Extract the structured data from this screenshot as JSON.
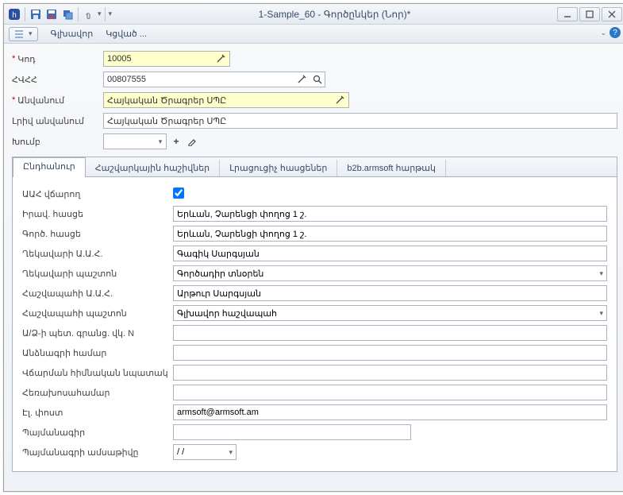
{
  "window": {
    "title": "1-Sample_60 - Գործընկեր (Նոր)*"
  },
  "menu": {
    "main": "Գլխավոր",
    "attached": "Կցված ..."
  },
  "form": {
    "code_label": "Կոդ",
    "code_value": "10005",
    "hvrr_label": "ՀՎՀՀ",
    "hvrr_value": "00807555",
    "name_label": "Անվանում",
    "name_value": "Հայկական Ծրագրեր ՍՊԸ",
    "fullname_label": "Լրիվ անվանում",
    "fullname_value": "Հայկական Ծրագրեր ՍՊԸ",
    "group_label": "Խումբ",
    "group_value": ""
  },
  "tabs": {
    "t1": "Ընդհանուր",
    "t2": "Հաշվարկային հաշիվներ",
    "t3": "Լրացուցիչ հասցեներ",
    "t4": "b2b.armsoft հարթակ"
  },
  "details": {
    "aah_payer_label": "ԱԱՀ վճարող",
    "aah_payer_checked": true,
    "legal_addr_label": "Իրավ. հասցե",
    "legal_addr_value": "Երևան, Չարենցի փողոց 1 շ.",
    "biz_addr_label": "Գործ. հասցե",
    "biz_addr_value": "Երևան, Չարենցի փողոց 1 շ.",
    "head_name_label": "Ղեկավարի Ա.Ա.Հ.",
    "head_name_value": "Գագիկ Սարգսյան",
    "head_pos_label": "Ղեկավարի պաշտոն",
    "head_pos_value": "Գործադիր տնօրեն",
    "acc_name_label": "Հաշվապահի Ա.Ա.Հ.",
    "acc_name_value": "Արթուր Սարգսյան",
    "acc_pos_label": "Հաշվապահի պաշտոն",
    "acc_pos_value": "Գլխավոր հաշվապահ",
    "state_reg_label": "Ա/Ձ-ի պետ. գրանց. վկ. N",
    "state_reg_value": "",
    "passport_label": "Անձնագրի համար",
    "passport_value": "",
    "pay_purpose_label": "Վճարման հիմնական նպատակ",
    "pay_purpose_value": "",
    "phone_label": "Հեռախոսահամար",
    "phone_value": "",
    "email_label": "Էլ. փոստ",
    "email_value": "armsoft@armsoft.am",
    "contract_label": "Պայմանագիր",
    "contract_value": "",
    "contract_date_label": "Պայմանագրի ամսաթիվը",
    "contract_date_value": "  /  /"
  }
}
